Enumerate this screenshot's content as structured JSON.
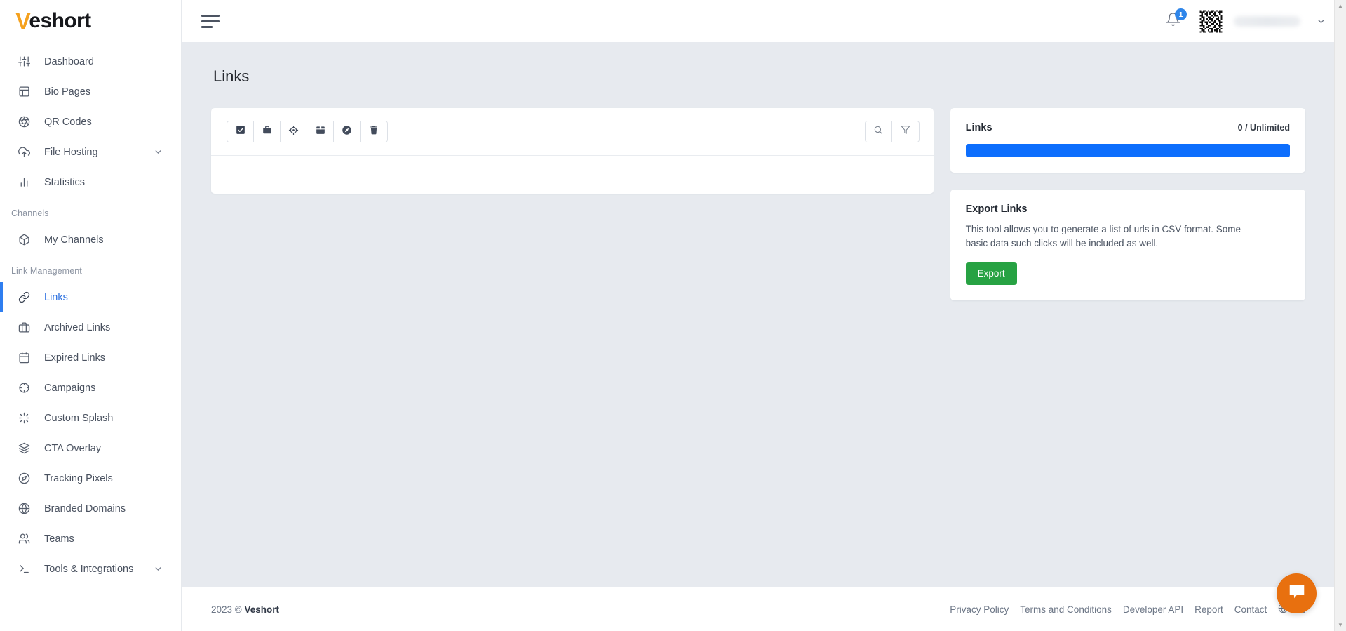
{
  "brand": {
    "initial": "V",
    "rest": "eshort"
  },
  "topbar": {
    "menu_toggle": "menu-toggle",
    "notification_count": "1",
    "username": ""
  },
  "sidebar": {
    "items": [
      {
        "label": "Dashboard",
        "icon": "sliders-icon",
        "active": false
      },
      {
        "label": "Bio Pages",
        "icon": "layout-icon",
        "active": false
      },
      {
        "label": "QR Codes",
        "icon": "aperture-icon",
        "active": false
      },
      {
        "label": "File Hosting",
        "icon": "cloud-upload-icon",
        "active": false,
        "caret": true
      },
      {
        "label": "Statistics",
        "icon": "bar-chart-icon",
        "active": false
      }
    ],
    "groups": [
      {
        "title": "Channels",
        "items": [
          {
            "label": "My Channels",
            "icon": "box-icon",
            "active": false
          }
        ]
      },
      {
        "title": "Link Management",
        "items": [
          {
            "label": "Links",
            "icon": "link-icon",
            "active": true
          },
          {
            "label": "Archived Links",
            "icon": "briefcase-icon",
            "active": false
          },
          {
            "label": "Expired Links",
            "icon": "calendar-icon",
            "active": false
          },
          {
            "label": "Campaigns",
            "icon": "crosshair-icon",
            "active": false
          },
          {
            "label": "Custom Splash",
            "icon": "loader-icon",
            "active": false
          },
          {
            "label": "CTA Overlay",
            "icon": "layers-icon",
            "active": false
          },
          {
            "label": "Tracking Pixels",
            "icon": "compass-icon",
            "active": false
          },
          {
            "label": "Branded Domains",
            "icon": "globe-icon",
            "active": false
          },
          {
            "label": "Teams",
            "icon": "users-icon",
            "active": false
          },
          {
            "label": "Tools & Integrations",
            "icon": "terminal-icon",
            "active": false,
            "caret": true
          }
        ]
      }
    ]
  },
  "page": {
    "title": "Links"
  },
  "toolbar": {
    "left_buttons": [
      {
        "name": "select-all-checkbox-button",
        "icon": "checkbox-checked-icon"
      },
      {
        "name": "archive-button",
        "icon": "briefcase-icon"
      },
      {
        "name": "campaign-button",
        "icon": "crosshair-icon"
      },
      {
        "name": "expire-button",
        "icon": "calendar-icon"
      },
      {
        "name": "pixel-button",
        "icon": "compass-icon"
      },
      {
        "name": "delete-button",
        "icon": "trash-icon"
      }
    ],
    "right_buttons": [
      {
        "name": "search-button",
        "icon": "search-icon"
      },
      {
        "name": "filter-button",
        "icon": "funnel-icon"
      }
    ]
  },
  "links_card": {
    "title": "Links",
    "count": "0 / Unlimited",
    "progress_percent": 100,
    "bar_color": "#0d6efd"
  },
  "export_card": {
    "title": "Export Links",
    "description": "This tool allows you to generate a list of urls in CSV format. Some basic data such clicks will be included as well.",
    "button_label": "Export",
    "button_color": "#27a243"
  },
  "footer": {
    "year": "2023 ©",
    "brand": "Veshort",
    "links": [
      "Privacy Policy",
      "Terms and Conditions",
      "Developer API",
      "Report",
      "Contact"
    ],
    "language": "EN"
  },
  "chat": {
    "icon": "chat-bubble-icon",
    "color": "#e8700f"
  }
}
